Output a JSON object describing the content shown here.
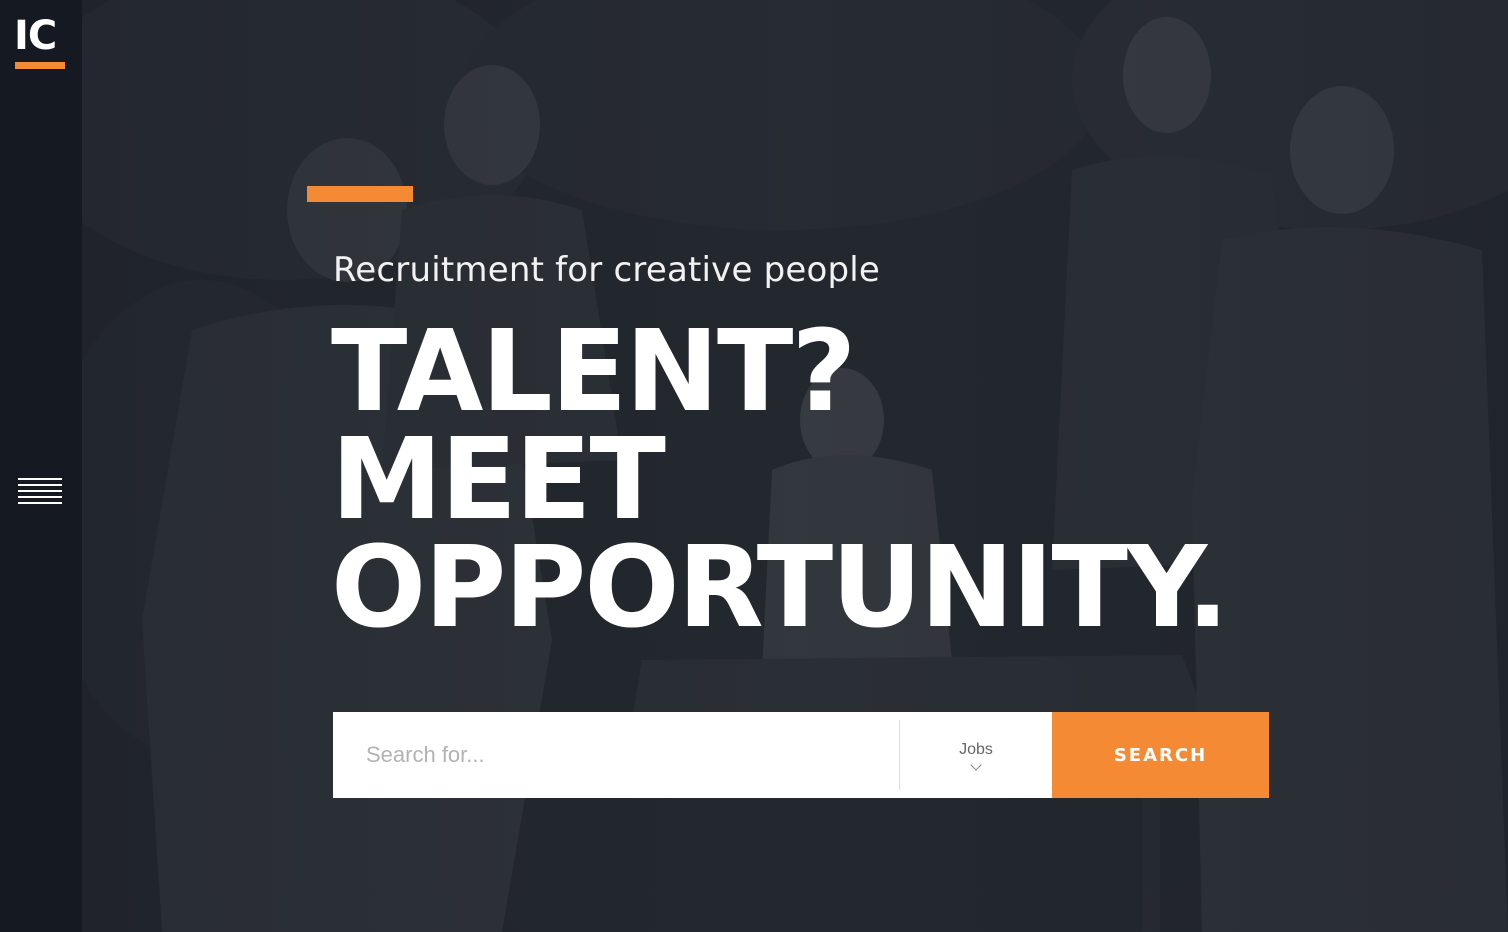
{
  "brand": {
    "logo_text": "IC",
    "accent_color": "#f58a35",
    "sidebar_color": "#141922"
  },
  "sidebar": {
    "menu_icon": "hamburger-menu-icon"
  },
  "hero": {
    "tagline": "Recruitment for creative people",
    "headline_lines": [
      "TALENT?",
      "MEET",
      "OPPORTUNITY."
    ]
  },
  "search": {
    "placeholder": "Search for...",
    "value": "",
    "category_selected": "Jobs",
    "category_icon": "chevron-down-icon",
    "button_label": "SEARCH"
  }
}
